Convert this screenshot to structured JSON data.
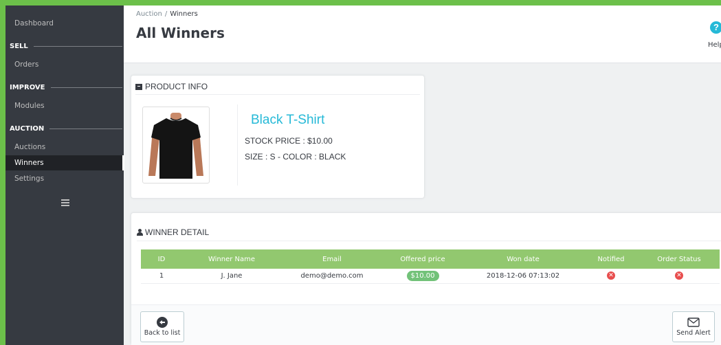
{
  "sidebar": {
    "dashboard": "Dashboard",
    "sections": [
      {
        "title": "SELL",
        "items": [
          "Orders"
        ]
      },
      {
        "title": "IMPROVE",
        "items": [
          "Modules"
        ]
      },
      {
        "title": "AUCTION",
        "items": [
          "Auctions",
          "Winners",
          "Settings"
        ]
      }
    ],
    "active_item": "Winners"
  },
  "header": {
    "breadcrumb_parent": "Auction",
    "breadcrumb_separator": "/",
    "breadcrumb_current": "Winners",
    "title": "All Winners",
    "help_label": "Help",
    "help_icon_glyph": "?"
  },
  "product": {
    "heading": "PRODUCT INFO",
    "name": "Black T-Shirt",
    "stock_price": "STOCK PRICE : $10.00",
    "attributes": "SIZE : S - COLOR : BLACK"
  },
  "winner_detail": {
    "heading": "WINNER DETAIL",
    "columns": [
      "ID",
      "Winner Name",
      "Email",
      "Offered price",
      "Won date",
      "Notified",
      "Order Status"
    ],
    "rows": [
      {
        "id": "1",
        "name": "J. Jane",
        "email": "demo@demo.com",
        "price": "$10.00",
        "won_date": "2018-12-06 07:13:02",
        "notified_glyph": "✕",
        "order_status_glyph": "✕"
      }
    ]
  },
  "buttons": {
    "back": "Back to list",
    "send_alert": "Send Alert"
  },
  "colors": {
    "accent": "#25b9d7",
    "table_header": "#92c86f",
    "badge": "#72c279",
    "error": "#e84e4e",
    "sidebar": "#363a41",
    "frame": "#6cc04a"
  }
}
